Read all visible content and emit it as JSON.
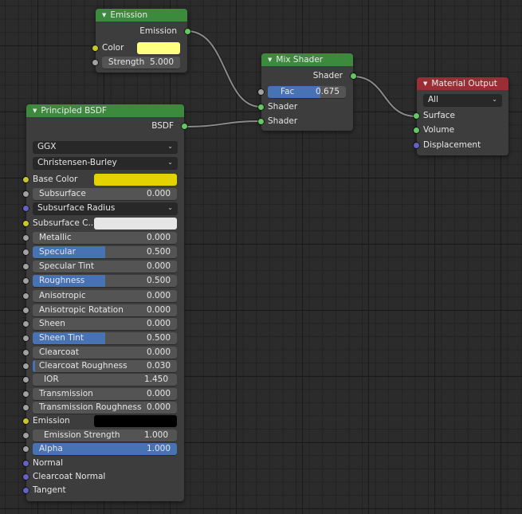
{
  "nodes": {
    "emission": {
      "title": "Emission",
      "output_label": "Emission",
      "color_label": "Color",
      "color_value": "#ffff80",
      "strength_label": "Strength",
      "strength_value": "5.000"
    },
    "mix_shader": {
      "title": "Mix Shader",
      "output_label": "Shader",
      "fac_label": "Fac",
      "fac_value": "0.675",
      "fac_fraction": 0.675,
      "input1_label": "Shader",
      "input2_label": "Shader"
    },
    "material_output": {
      "title": "Material Output",
      "target_selected": "All",
      "inputs": [
        "Surface",
        "Volume",
        "Displacement"
      ]
    },
    "principled": {
      "title": "Principled BSDF",
      "output_label": "BSDF",
      "distribution": "GGX",
      "subsurface_method": "Christensen-Burley",
      "base_color_label": "Base Color",
      "base_color_value": "#e5d300",
      "subsurface_color_label": "Subsurface C...",
      "subsurface_color_value": "#e6e6e6",
      "subsurface_radius_label": "Subsurface Radius",
      "emission_label": "Emission",
      "emission_color_value": "#000000",
      "sliders": [
        {
          "label": "Subsurface",
          "value": "0.000",
          "fraction": 0.0
        },
        {
          "label": "Metallic",
          "value": "0.000",
          "fraction": 0.0
        },
        {
          "label": "Specular",
          "value": "0.500",
          "fraction": 0.5
        },
        {
          "label": "Specular Tint",
          "value": "0.000",
          "fraction": 0.0
        },
        {
          "label": "Roughness",
          "value": "0.500",
          "fraction": 0.5
        },
        {
          "label": "Anisotropic",
          "value": "0.000",
          "fraction": 0.0
        },
        {
          "label": "Anisotropic Rotation",
          "value": "0.000",
          "fraction": 0.0
        },
        {
          "label": "Sheen",
          "value": "0.000",
          "fraction": 0.0
        },
        {
          "label": "Sheen Tint",
          "value": "0.500",
          "fraction": 0.5
        },
        {
          "label": "Clearcoat",
          "value": "0.000",
          "fraction": 0.0
        },
        {
          "label": "Clearcoat Roughness",
          "value": "0.030",
          "fraction": 0.03
        },
        {
          "label": "IOR",
          "value": "1.450"
        },
        {
          "label": "Transmission",
          "value": "0.000",
          "fraction": 0.0
        },
        {
          "label": "Transmission Roughness",
          "value": "0.000",
          "fraction": 0.0
        },
        {
          "label": "Emission Strength",
          "value": "1.000"
        },
        {
          "label": "Alpha",
          "value": "1.000",
          "fraction": 1.0
        }
      ],
      "vector_inputs": [
        "Normal",
        "Clearcoat Normal",
        "Tangent"
      ]
    }
  },
  "colors": {
    "accent_slider": "#4772b3",
    "shader_header": "#3c8a3c",
    "output_header": "#9c2d35",
    "wire": "#8a8a8a"
  }
}
